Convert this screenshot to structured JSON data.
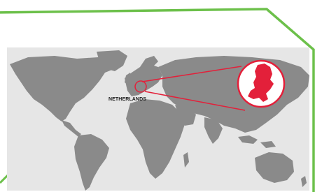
{
  "map": {
    "country_label": "NETHERLANDS",
    "icons": {
      "frame": "green-frame-border",
      "magnifier": "zoom-callout-circle",
      "country_shape": "netherlands-country-icon"
    },
    "colors": {
      "frame": "#6cc04a",
      "land": "#8a8a8a",
      "ocean": "#e6e6e6",
      "highlight": "#e3203a"
    }
  }
}
